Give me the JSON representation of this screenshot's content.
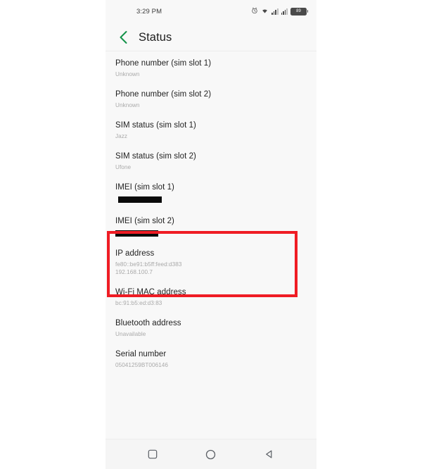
{
  "status_bar": {
    "time": "3:29 PM",
    "alarm_icon": "alarm-icon",
    "wifi_icon": "wifi-icon",
    "signal_sim1_icon": "signal-bars-icon",
    "signal_sim2_icon": "signal-bars-icon",
    "battery_icon": "battery-icon",
    "battery_level": "89"
  },
  "app_bar": {
    "back_icon": "back-chevron-icon",
    "title": "Status"
  },
  "list": {
    "items": [
      {
        "label": "Phone number (sim slot 1)",
        "value": "Unknown",
        "redacted": false
      },
      {
        "label": "Phone number (sim slot 2)",
        "value": "Unknown",
        "redacted": false
      },
      {
        "label": "SIM status (sim slot 1)",
        "value": "Jazz",
        "redacted": false
      },
      {
        "label": "SIM status (sim slot 2)",
        "value": "Ufone",
        "redacted": false
      },
      {
        "label": "IMEI (sim slot 1)",
        "value": "",
        "redacted": true
      },
      {
        "label": "IMEI (sim slot 2)",
        "value": "",
        "redacted": true
      },
      {
        "label": "IP address",
        "value": "fe80::be91:b5ff:feed:d383",
        "value2": "192.168.100.7",
        "redacted": false
      },
      {
        "label": "Wi-Fi MAC address",
        "value": "bc:91:b5:ed:d3:83",
        "redacted": false
      },
      {
        "label": "Bluetooth address",
        "value": "Unavailable",
        "redacted": false
      },
      {
        "label": "Serial number",
        "value": "05041259BT006146",
        "redacted": false
      }
    ]
  },
  "highlight": {
    "color": "#ef1c24",
    "target": "imei-rows"
  },
  "nav_bar": {
    "recents_icon": "square-recents-icon",
    "home_icon": "circle-home-icon",
    "back_icon": "triangle-back-icon"
  },
  "colors": {
    "accent_green": "#14924a",
    "screen_bg": "#f8f8f8",
    "label": "#1f1f1f",
    "value": "#a9a9a9"
  }
}
